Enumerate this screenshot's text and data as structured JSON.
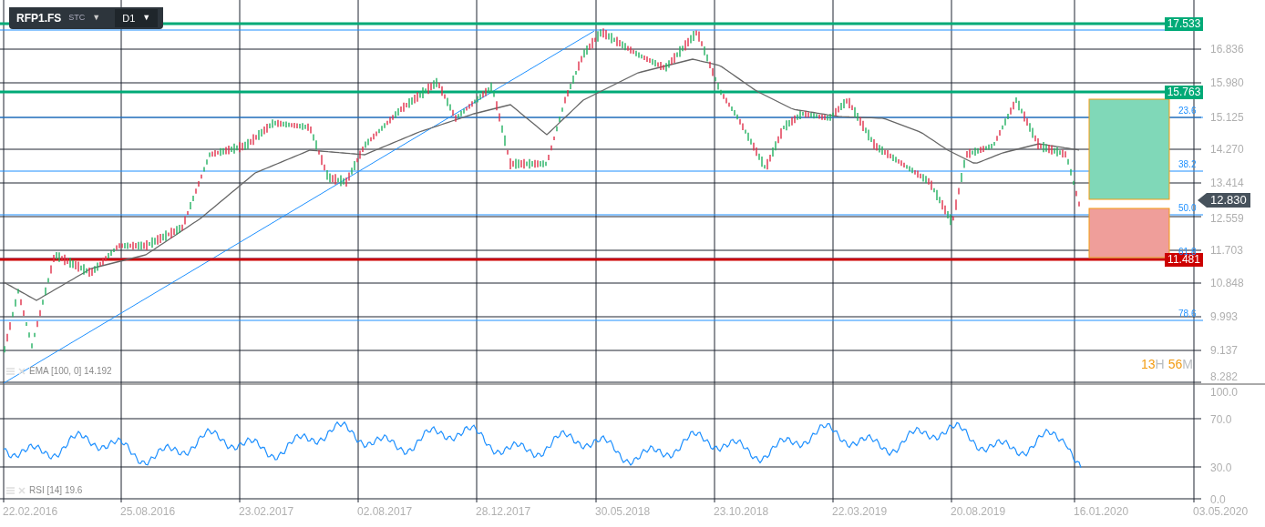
{
  "toolbar": {
    "symbol": "RFP1.FS",
    "market": "STC",
    "market_caret": "▼",
    "timeframe": "D1",
    "timeframe_caret": "▼"
  },
  "price_axis": [
    "16.836",
    "15.980",
    "15.125",
    "14.270",
    "13.414",
    "12.559",
    "11.703",
    "10.848",
    "9.993",
    "9.137",
    "8.282"
  ],
  "rsi_axis": [
    "100.0",
    "70.0",
    "30.0",
    "0.0"
  ],
  "date_axis": [
    "22.02.2016",
    "25.08.2016",
    "23.02.2017",
    "02.08.2017",
    "28.12.2017",
    "30.05.2018",
    "23.10.2018",
    "22.03.2019",
    "20.08.2019",
    "16.01.2020",
    "03.05.2020"
  ],
  "price_levels": [
    {
      "label": "17.533",
      "color": "#00aa77"
    },
    {
      "label": "15.763",
      "color": "#00aa77"
    },
    {
      "label": "11.481",
      "color": "#cc0000"
    }
  ],
  "fib_levels": [
    "23.6",
    "38.2",
    "50.0",
    "61.8",
    "78.6"
  ],
  "current_price": "12.830",
  "countdown": {
    "hours": "13",
    "hours_unit": "H",
    "minutes": "56",
    "minutes_unit": "M"
  },
  "indicators": [
    "EMA [100, 0] 14.192",
    "RSI [14] 19.6"
  ]
}
